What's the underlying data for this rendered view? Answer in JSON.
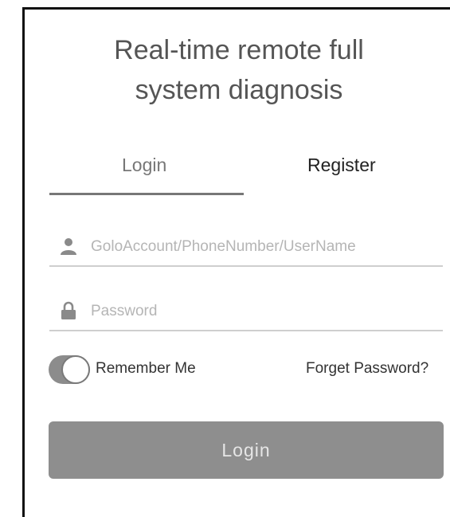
{
  "title": {
    "line1": "Real-time remote full",
    "line2": "system diagnosis"
  },
  "tabs": {
    "login": "Login",
    "register": "Register",
    "active": "Login"
  },
  "account_field": {
    "icon": "user-icon",
    "placeholder": "GoloAccount/PhoneNumber/UserName",
    "value": ""
  },
  "password_field": {
    "icon": "lock-icon",
    "placeholder": "Password",
    "value": ""
  },
  "remember_me": {
    "label": "Remember Me",
    "checked": true
  },
  "forget_password_link": "Forget Password?",
  "login_button": "Login",
  "colors": {
    "button": "#8e8e8e",
    "tab_indicator": "#777777",
    "toggle_track": "#8c8c8c"
  }
}
